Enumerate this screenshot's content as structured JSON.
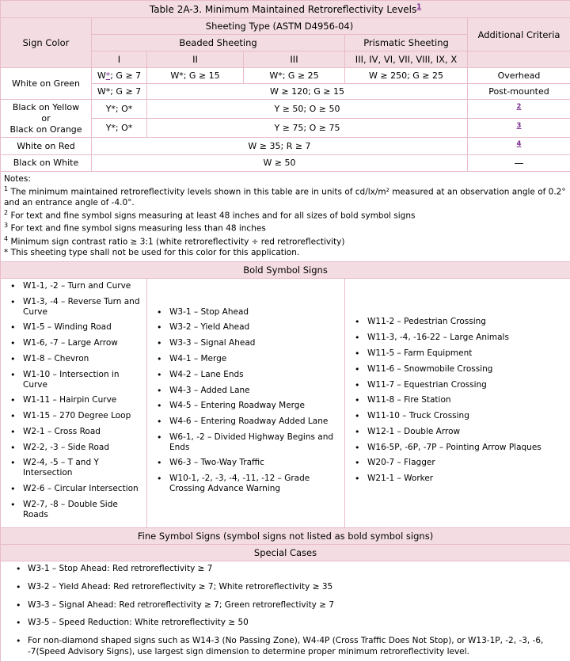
{
  "table": {
    "title": "Table 2A-3. Minimum Maintained Retroreflectivity Levels",
    "title_footnote": "1",
    "headers": {
      "sign_color": "Sign Color",
      "sheeting_type": "Sheeting Type (ASTM D4956-04)",
      "beaded_sheeting": "Beaded Sheeting",
      "prismatic_sheeting": "Prismatic Sheeting",
      "additional_criteria": "Additional Criteria",
      "col_i": "I",
      "col_ii": "II",
      "col_iii": "III",
      "col_prismatic": "III, IV, VI, VII, VIII, IX, X"
    },
    "rows": [
      {
        "label": "White on Green",
        "label_rowspan": 2,
        "cells": [
          {
            "text": "W*; G ≥ 7",
            "star_link": true
          },
          {
            "text": "W*; G ≥ 15"
          },
          {
            "text": "W*; G ≥ 25"
          },
          {
            "text": "W ≥ 250; G ≥ 25"
          }
        ],
        "additional": "Overhead"
      },
      {
        "label": "",
        "cells": [
          {
            "text": "W*; G ≥ 7"
          },
          {
            "text": "W ≥ 120; G ≥ 15",
            "colspan": 3
          }
        ],
        "additional": "Post-mounted"
      },
      {
        "label": "Black on Yellow\nor\nBlack on Orange",
        "label_rowspan": 2,
        "cells": [
          {
            "text": "Y*; O*"
          },
          {
            "text": "Y ≥ 50; O ≥ 50",
            "colspan": 3
          }
        ],
        "additional_footnote": "2"
      },
      {
        "label": "",
        "cells": [
          {
            "text": "Y*; O*"
          },
          {
            "text": "Y ≥ 75; O ≥ 75",
            "colspan": 3
          }
        ],
        "additional_footnote": "3"
      },
      {
        "label": "White on Red",
        "cells": [
          {
            "text": "W ≥ 35; R ≥ 7",
            "colspan": 4
          }
        ],
        "additional_footnote": "4"
      },
      {
        "label": "Black on White",
        "cells": [
          {
            "text": "W ≥ 50",
            "colspan": 4
          }
        ],
        "additional": "—"
      }
    ]
  },
  "notes": {
    "heading": "Notes:",
    "items": [
      {
        "marker": "1",
        "text": "The minimum maintained retroreflectivity levels shown in this table are in units of cd/lx/m² measured at an observation angle of 0.2° and an entrance angle of -4.0°."
      },
      {
        "marker": "2",
        "text": "For text and fine symbol signs measuring at least 48 inches and for all sizes of bold symbol signs"
      },
      {
        "marker": "3",
        "text": "For text and fine symbol signs measuring less than 48 inches"
      },
      {
        "marker": "4",
        "text": "Minimum sign contrast ratio ≥ 3:1 (white retroreflectivity ÷ red retroreflectivity)"
      },
      {
        "marker": "*",
        "text": "This sheeting type shall not be used for this color for this application."
      }
    ]
  },
  "bold_symbol_signs": {
    "heading": "Bold Symbol Signs",
    "column1": [
      "W1-1, -2 – Turn and Curve",
      "W1-3, -4 – Reverse Turn and Curve",
      "W1-5 – Winding Road",
      "W1-6, -7 – Large Arrow",
      "W1-8 – Chevron",
      "W1-10 – Intersection in Curve",
      "W1-11 – Hairpin Curve",
      "W1-15 – 270 Degree Loop",
      "W2-1 – Cross Road",
      "W2-2, -3 – Side Road",
      "W2-4, -5 – T and Y Intersection",
      "W2-6 – Circular Intersection",
      "W2-7, -8 – Double Side Roads"
    ],
    "column2": [
      "W3-1 – Stop Ahead",
      "W3-2 – Yield Ahead",
      "W3-3 – Signal Ahead",
      "W4-1 – Merge",
      "W4-2 – Lane Ends",
      "W4-3 – Added Lane",
      "W4-5 – Entering Roadway Merge",
      "W4-6 – Entering Roadway Added Lane",
      "W6-1, -2 – Divided Highway Begins and Ends",
      "W6-3 – Two-Way Traffic",
      "W10-1, -2, -3, -4, -11, -12 – Grade Crossing Advance Warning"
    ],
    "column3": [
      "W11-2 – Pedestrian Crossing",
      "W11-3, -4, -16-22 – Large Animals",
      "W11-5 – Farm Equipment",
      "W11-6 – Snowmobile Crossing",
      "W11-7 – Equestrian Crossing",
      "W11-8 – Fire Station",
      "W11-10 – Truck Crossing",
      "W12-1 – Double Arrow",
      "W16-5P, -6P, -7P – Pointing Arrow Plaques",
      "W20-7 – Flagger",
      "W21-1 – Worker"
    ]
  },
  "fine_symbol_signs": {
    "heading": "Fine Symbol Signs (symbol signs not listed as bold symbol signs)"
  },
  "special_cases": {
    "heading": "Special Cases",
    "items": [
      "W3-1 – Stop Ahead: Red retroreflectivity ≥ 7",
      "W3-2 – Yield Ahead: Red retroreflectivity ≥ 7; White retroreflectivity ≥ 35",
      "W3-3 – Signal Ahead: Red retroreflectivity ≥ 7; Green retroreflectivity ≥ 7",
      "W3-5 – Speed Reduction: White retroreflectivity ≥ 50",
      "For non-diamond shaped signs such as W14-3 (No Passing Zone), W4-4P (Cross Traffic Does Not Stop), or W13-1P, -2, -3, -6, -7(Speed Advisory Signs), use largest sign dimension to determine proper minimum retroreflectivity level."
    ]
  },
  "colors": {
    "header_bg": "#f3dde3",
    "border": "#e8bcc8",
    "link": "#7a2f8f",
    "body_bg": "#ffffff"
  }
}
